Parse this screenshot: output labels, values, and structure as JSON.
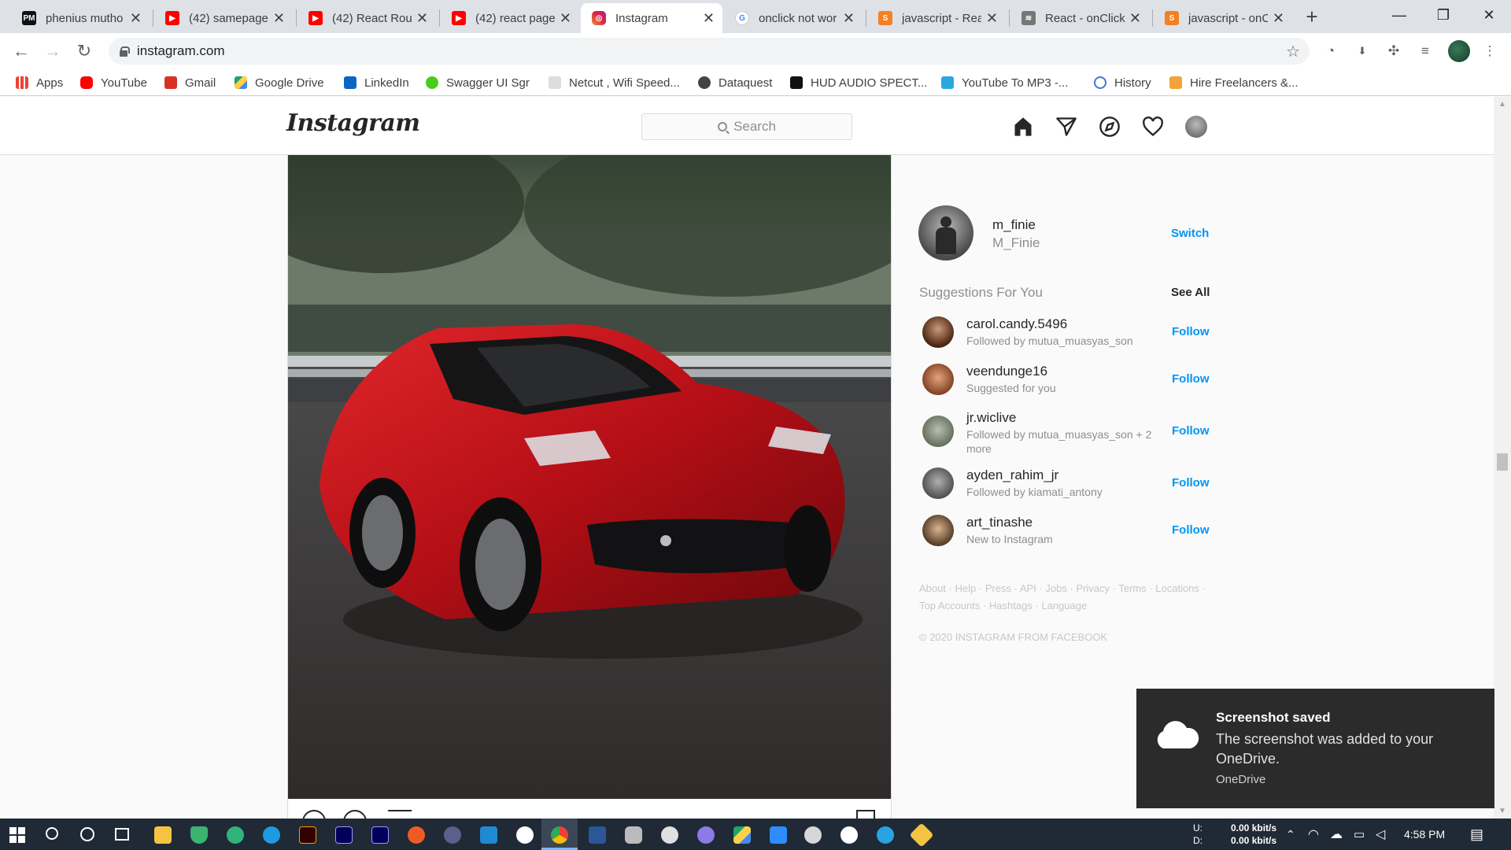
{
  "browser": {
    "tabs": [
      {
        "title": "phenius mutho",
        "favicon": "pm-icon",
        "color": "#111111"
      },
      {
        "title": "(42) samepage",
        "favicon": "youtube-icon",
        "color": "#ff0000"
      },
      {
        "title": "(42) React Rou",
        "favicon": "youtube-icon",
        "color": "#ff0000"
      },
      {
        "title": "(42) react page",
        "favicon": "youtube-icon",
        "color": "#ff0000"
      },
      {
        "title": "Instagram",
        "favicon": "instagram-icon",
        "color": "#d6249f",
        "active": true
      },
      {
        "title": "onclick not wor",
        "favicon": "google-icon",
        "color": "#4285f4"
      },
      {
        "title": "javascript - Rea",
        "favicon": "stackoverflow-icon",
        "color": "#f48024"
      },
      {
        "title": "React - onClick",
        "favicon": "feather-icon",
        "color": "#555555"
      },
      {
        "title": "javascript - onC",
        "favicon": "stackoverflow-icon",
        "color": "#f48024"
      }
    ],
    "url": "instagram.com",
    "bookmarks": [
      {
        "label": "Apps",
        "icon": "apps-icon",
        "color": "#4285f4"
      },
      {
        "label": "YouTube",
        "icon": "youtube-icon",
        "color": "#ff0000"
      },
      {
        "label": "Gmail",
        "icon": "gmail-icon",
        "color": "#d93025"
      },
      {
        "label": "Google Drive",
        "icon": "drive-icon",
        "color": "#1fa463"
      },
      {
        "label": "LinkedIn",
        "icon": "linkedin-icon",
        "color": "#0a66c2"
      },
      {
        "label": "Swagger UI Sgr",
        "icon": "swagger-icon",
        "color": "#49cc1b"
      },
      {
        "label": "Netcut , Wifi Speed...",
        "icon": "netcut-icon",
        "color": "#cccccc"
      },
      {
        "label": "Dataquest",
        "icon": "dataquest-icon",
        "color": "#444444"
      },
      {
        "label": "HUD AUDIO SPECT...",
        "icon": "hud-icon",
        "color": "#111111"
      },
      {
        "label": "YouTube To MP3 -...",
        "icon": "download-icon",
        "color": "#29a8e0"
      },
      {
        "label": "History",
        "icon": "history-icon",
        "color": "#3c78d8"
      },
      {
        "label": "Hire Freelancers &...",
        "icon": "freelancer-icon",
        "color": "#f2a33a"
      }
    ]
  },
  "instagram": {
    "logo": "Instagram",
    "search_placeholder": "Search",
    "me": {
      "username": "m_finie",
      "name": "M_Finie",
      "switch": "Switch"
    },
    "suggestions_title": "Suggestions For You",
    "see_all": "See All",
    "suggestions": [
      {
        "username": "carol.candy.5496",
        "sub": "Followed by mutua_muasyas_son",
        "action": "Follow",
        "avatar": "#6b3b24"
      },
      {
        "username": "veendunge16",
        "sub": "Suggested for you",
        "action": "Follow",
        "avatar": "#c7805a"
      },
      {
        "username": "jr.wiclive",
        "sub": "Followed by mutua_muasyas_son + 2 more",
        "action": "Follow",
        "avatar": "#8a9a84"
      },
      {
        "username": "ayden_rahim_jr",
        "sub": "Followed by kiamati_antony",
        "action": "Follow",
        "avatar": "#7a7a7a"
      },
      {
        "username": "art_tinashe",
        "sub": "New to Instagram",
        "action": "Follow",
        "avatar": "#a0744f"
      }
    ],
    "footer_links": "About · Help · Press · API · Jobs · Privacy · Terms · Locations · Top Accounts · Hashtags · Language",
    "copyright": "© 2020 INSTAGRAM FROM FACEBOOK"
  },
  "toast": {
    "title": "Screenshot saved",
    "body": "The screenshot was added to your OneDrive.",
    "source": "OneDrive"
  },
  "taskbar": {
    "net_up_label": "U:",
    "net_down_label": "D:",
    "net_up": "0.00 kbit/s",
    "net_down": "0.00 kbit/s",
    "time": "4:58 PM"
  }
}
